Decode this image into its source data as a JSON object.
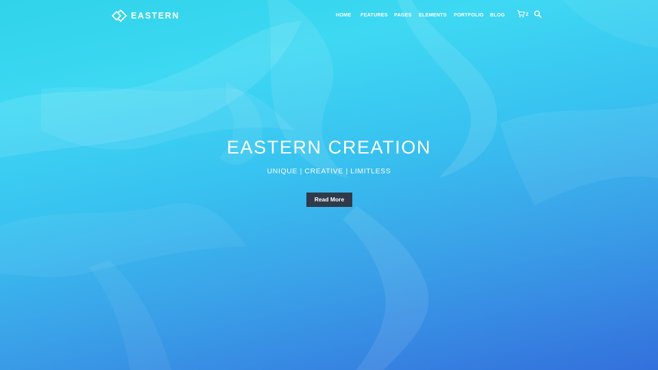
{
  "header": {
    "logo_text": "EASTERN",
    "nav_items": [
      {
        "label": "HOME"
      },
      {
        "label": "FEATURES"
      },
      {
        "label": "PAGES"
      },
      {
        "label": "ELEMENTS"
      },
      {
        "label": "PORTFOLIO"
      },
      {
        "label": "BLOG"
      }
    ],
    "cart_count": "2"
  },
  "hero": {
    "title": "EASTERN CREATION",
    "subtitle": "UNIQUE | CREATIVE | LIMITLESS",
    "cta_label": "Read More"
  },
  "colors": {
    "gradient_top": "#3ed8f3",
    "gradient_bottom": "#3370dc",
    "button_bg": "#2f3a4a",
    "text": "#ffffff"
  },
  "icons": [
    "logo-diamond-icon",
    "cart-icon",
    "search-icon"
  ]
}
